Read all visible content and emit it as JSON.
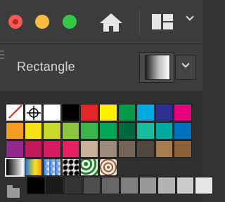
{
  "toolbar": {
    "traffic": [
      {
        "name": "close-window-button",
        "color": "#fc5753"
      },
      {
        "name": "minimize-window-button",
        "color": "#fdbc40"
      },
      {
        "name": "zoom-window-button",
        "color": "#33c748"
      }
    ],
    "home_icon": "home-icon",
    "workspace_icon": "workspace-layout-icon",
    "workspace_dropdown_icon": "chevron-down-icon"
  },
  "properties": {
    "object_type": "Rectangle",
    "fill_swatch_icon": "gradient-swatch",
    "fill_dropdown_icon": "chevron-down-icon"
  },
  "swatches": {
    "rows": [
      [
        "none",
        "registration",
        "#ffffff",
        "#000000",
        "#e32626",
        "#fff200",
        "#009b48",
        "#00a9e0",
        "#2e3192",
        "#e6007e"
      ],
      [
        "#f39c1f",
        "#f7e11e",
        "#c8d92b",
        "#8cc63f",
        "#39b54a",
        "#00a651",
        "#00693e",
        "#1abc9c",
        "#00a99d",
        "#0071bc"
      ],
      [
        "#92278f",
        "#c2185b",
        "#d81b60",
        "#e91e63",
        "#c7b299",
        "#9c8b7a",
        "#736357",
        "#534741",
        "#a67c52",
        "#8c6239"
      ],
      [
        "#bdbdbd",
        "#e8892c",
        "#1f6fd6",
        "#000000",
        "#2e7d32",
        "#8d5a3b",
        "",
        "",
        "",
        ""
      ],
      [
        "#000000",
        "#1a1a1a",
        "#333333",
        "#4d4d4d",
        "#666666",
        "#808080",
        "#999999",
        "#b3b3b3",
        "#cccccc",
        "#e6e6e6"
      ]
    ],
    "special_row": [
      {
        "name": "gradient-swatch-selected"
      },
      {
        "name": "gradient-swatch-orange-yellow"
      },
      {
        "name": "gradient-swatch-blue-transparent"
      },
      {
        "name": "gradient-swatch-radial-black"
      },
      {
        "name": "pattern-swatch-foliage"
      },
      {
        "name": "pattern-swatch-paisley"
      }
    ]
  }
}
